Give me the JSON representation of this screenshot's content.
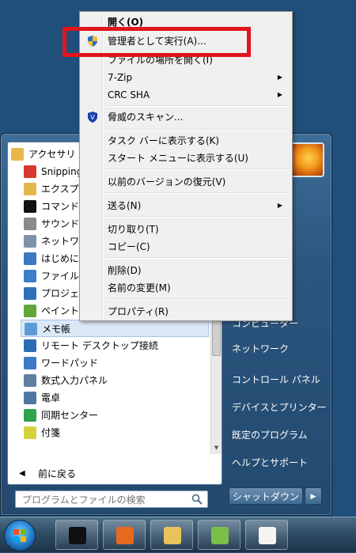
{
  "start_menu": {
    "folder": {
      "label": "アクセサリ",
      "icon": "folder-icon"
    },
    "programs": [
      {
        "label": "Snipping",
        "icon": "scissors-icon",
        "color": "#d43a2f"
      },
      {
        "label": "エクスプ",
        "icon": "explorer-folder-icon",
        "color": "#e2b74c"
      },
      {
        "label": "コマンド",
        "icon": "cmd-icon",
        "color": "#111111"
      },
      {
        "label": "サウンド",
        "icon": "microphone-icon",
        "color": "#8a8a8a"
      },
      {
        "label": "ネットワ",
        "icon": "network-icon",
        "color": "#7f93a8"
      },
      {
        "label": "はじめに",
        "icon": "document-icon",
        "color": "#3a78c2"
      },
      {
        "label": "ファイル",
        "icon": "file-transfer-icon",
        "color": "#3c7cc8"
      },
      {
        "label": "プロジェ",
        "icon": "projector-icon",
        "color": "#2e70b8"
      },
      {
        "label": "ペイント",
        "icon": "paint-icon",
        "color": "#5fa73a"
      },
      {
        "label": "メモ帳",
        "icon": "notepad-icon",
        "color": "#5b9bd5"
      },
      {
        "label": "リモート デスクトップ接続",
        "icon": "remote-desktop-icon",
        "color": "#2b6cb5"
      },
      {
        "label": "ワードパッド",
        "icon": "wordpad-icon",
        "color": "#3d7bc6"
      },
      {
        "label": "数式入力パネル",
        "icon": "math-panel-icon",
        "color": "#5f7f9f"
      },
      {
        "label": "電卓",
        "icon": "calculator-icon",
        "color": "#4f77a1"
      },
      {
        "label": "同期センター",
        "icon": "sync-icon",
        "color": "#2fa34b"
      },
      {
        "label": "付箋",
        "icon": "sticky-note-icon",
        "color": "#d6d23b"
      }
    ],
    "selected_index": 9,
    "back_label": "前に戻る",
    "search_placeholder": "プログラムとファイルの検索",
    "right_items": [
      "コンピューター",
      "ネットワーク",
      "コントロール パネル",
      "デバイスとプリンター",
      "既定のプログラム",
      "ヘルプとサポート"
    ],
    "shutdown_label": "シャットダウン"
  },
  "context_menu": {
    "items": [
      {
        "label": "開く(O)",
        "bold": true
      },
      {
        "label": "管理者として実行(A)...",
        "icon": "uac-shield-icon"
      },
      {
        "label": "ファイルの場所を開く(I)"
      },
      {
        "label": "7-Zip",
        "submenu": true
      },
      {
        "label": "CRC SHA",
        "submenu": true
      },
      {
        "label": "脅威のスキャン...",
        "icon": "antivirus-icon"
      },
      {
        "label": "タスク バーに表示する(K)"
      },
      {
        "label": "スタート メニューに表示する(U)"
      },
      {
        "label": "以前のバージョンの復元(V)"
      },
      {
        "label": "送る(N)",
        "submenu": true
      },
      {
        "label": "切り取り(T)"
      },
      {
        "label": "コピー(C)"
      },
      {
        "label": "削除(D)"
      },
      {
        "label": "名前の変更(M)"
      },
      {
        "label": "プロパティ(R)"
      }
    ],
    "highlight_color": "#e3141b"
  },
  "taskbar": {
    "buttons": [
      {
        "name": "cmd-taskbar-button",
        "icon": "cmd-icon",
        "color": "#111111"
      },
      {
        "name": "firefox-taskbar-button",
        "icon": "firefox-icon",
        "color": "#e66a1e"
      },
      {
        "name": "explorer-taskbar-button",
        "icon": "explorer-folder-icon",
        "color": "#e8c25a"
      },
      {
        "name": "paint-taskbar-button",
        "icon": "paint-icon",
        "color": "#7bbf4a"
      },
      {
        "name": "notepad-taskbar-button",
        "icon": "notepad-icon",
        "color": "#f4f4f4"
      }
    ]
  }
}
